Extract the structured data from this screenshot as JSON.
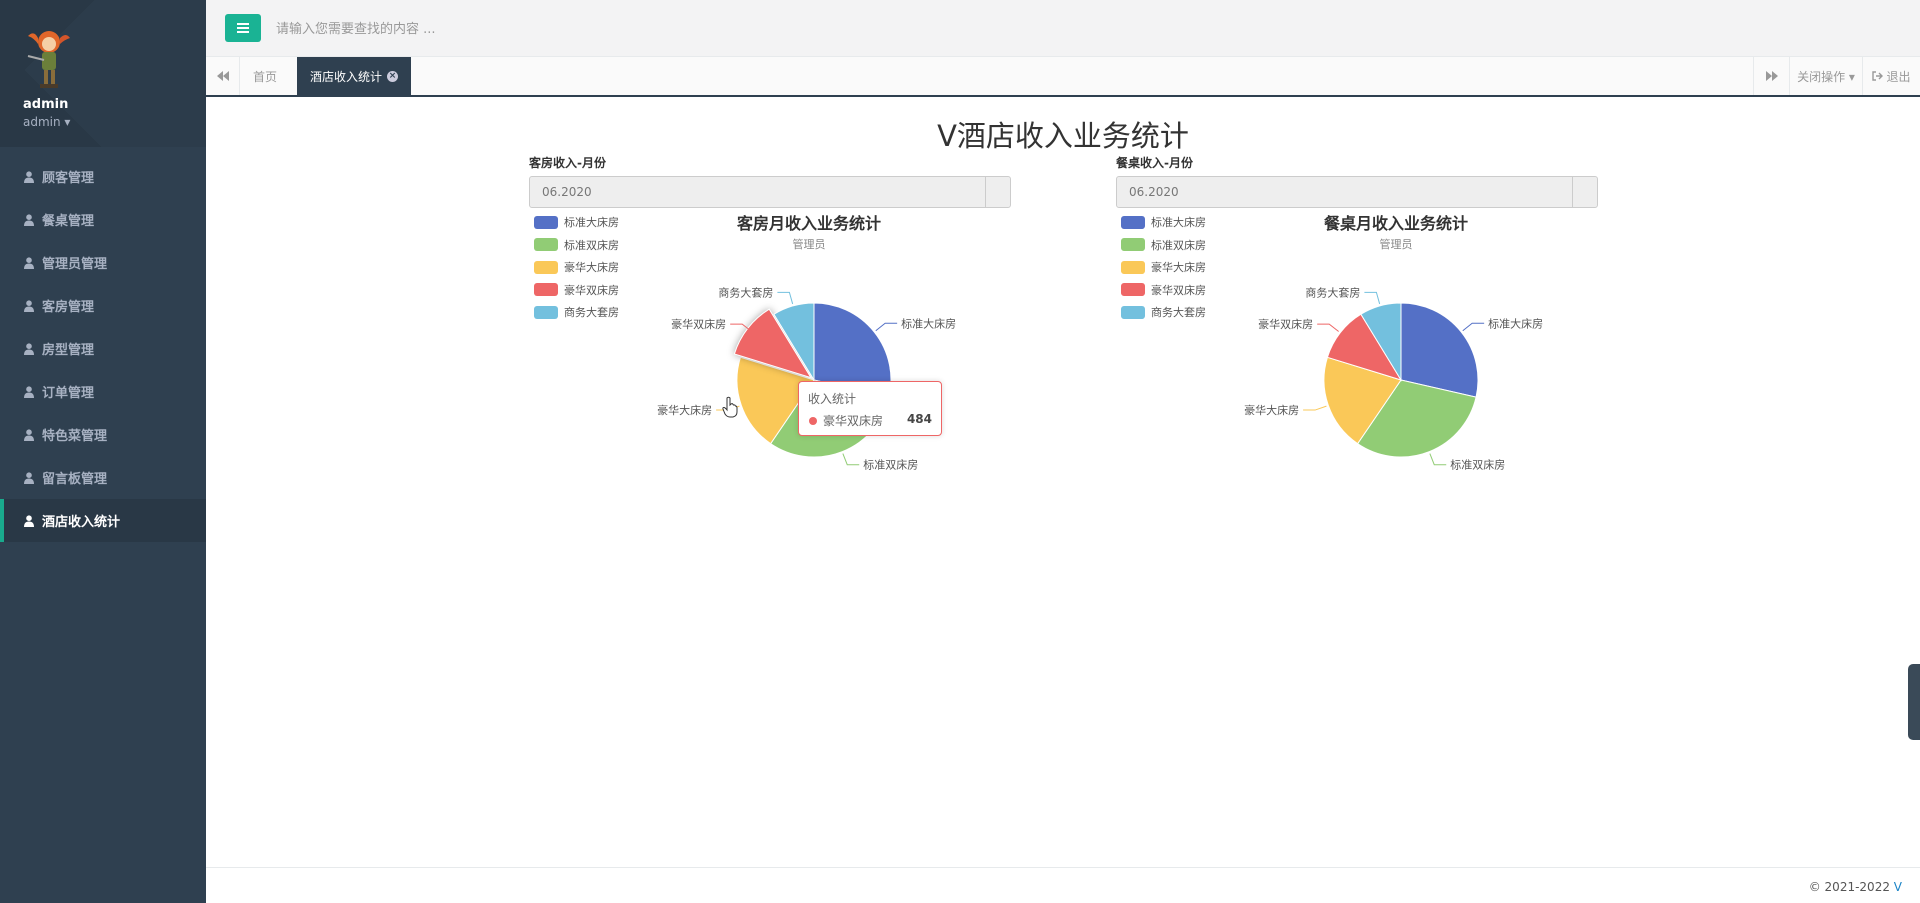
{
  "sidebar": {
    "profile": {
      "name": "admin",
      "role": "admin ▾"
    },
    "items": [
      {
        "label": "顾客管理"
      },
      {
        "label": "餐桌管理"
      },
      {
        "label": "管理员管理"
      },
      {
        "label": "客房管理"
      },
      {
        "label": "房型管理"
      },
      {
        "label": "订单管理"
      },
      {
        "label": "特色菜管理"
      },
      {
        "label": "留言板管理"
      },
      {
        "label": "酒店收入统计",
        "active": true
      }
    ]
  },
  "topbar": {
    "search_placeholder": "请输入您需要查找的内容 ..."
  },
  "tabs": {
    "items": [
      {
        "label": "首页"
      },
      {
        "label": "酒店收入统计",
        "active": true
      }
    ],
    "close_ops": "关闭操作 ▾",
    "logout": "退出"
  },
  "page": {
    "title": "V酒店收入业务统计"
  },
  "colors": {
    "accent": "#1ab394",
    "sidebar": "#2f4050"
  },
  "panels": [
    {
      "label": "客房收入-月份",
      "month": "06.2020"
    },
    {
      "label": "餐桌收入-月份",
      "month": "06.2020"
    }
  ],
  "tooltip": {
    "title": "收入统计",
    "name": "豪华双床房",
    "value": "484"
  },
  "chart_data": [
    {
      "type": "pie",
      "title": "客房月收入业务统计",
      "subtitle": "管理员",
      "legend_position": "top-left",
      "categories": [
        "标准大床房",
        "标准双床房",
        "豪华大床房",
        "豪华双床房",
        "商务大套房"
      ],
      "values": [
        1200,
        1300,
        850,
        484,
        366
      ],
      "colors": [
        "#5470c6",
        "#91cc75",
        "#fac858",
        "#ee6666",
        "#73c0de"
      ],
      "highlighted": "豪华双床房"
    },
    {
      "type": "pie",
      "title": "餐桌月收入业务统计",
      "subtitle": "管理员",
      "legend_position": "top-left",
      "categories": [
        "标准大床房",
        "标准双床房",
        "豪华大床房",
        "豪华双床房",
        "商务大套房"
      ],
      "values": [
        1200,
        1300,
        850,
        484,
        366
      ],
      "colors": [
        "#5470c6",
        "#91cc75",
        "#fac858",
        "#ee6666",
        "#73c0de"
      ]
    }
  ],
  "footer": {
    "text": "© 2021-2022 ",
    "brand": "V"
  }
}
